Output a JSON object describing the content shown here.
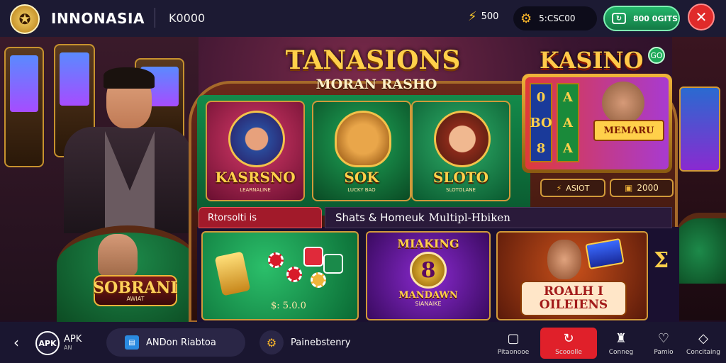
{
  "header": {
    "logo_icon": "crest-logo-icon",
    "brand": "INNONASIA",
    "balance": "K0000",
    "stars": "500",
    "coins": "5:CSC00",
    "deposit_label": "800 0GITS",
    "close_icon": "close-icon"
  },
  "hero": {
    "title": "TANASIONS",
    "subtitle": "MORAN RASHO"
  },
  "games": [
    {
      "name": "KASRSNO",
      "tag": "LEARNALINE"
    },
    {
      "name": "SOK",
      "tag": "LUCKY BAO"
    },
    {
      "name": "SLOTO",
      "tag": "SLOTOLANE"
    }
  ],
  "featured": {
    "title": "KASINO",
    "badge": "GO",
    "reel_a": [
      "0",
      "BO",
      "8"
    ],
    "reel_b": [
      "A",
      "A",
      "A"
    ],
    "label": "MEMARU",
    "button1": "ASIOT",
    "button2": "2000"
  },
  "sections": {
    "tab": "Rtorsolti is",
    "bar_prefix": "Shats & Homeuk",
    "bar_suffix": "Multipl-Hbiken"
  },
  "lower_tiles": {
    "tile1_price": "5.0.0",
    "tile1_price_prefix": "$:",
    "tile2_top": "MIAKING",
    "tile2_number": "8",
    "tile2_bottom": "MANDAWN",
    "tile2_tag": "SIANAIKE",
    "tile3_line1": "ROALH I",
    "tile3_line2": "OILEIENS"
  },
  "left_badge": {
    "title": "SOBRANI",
    "tag": "AWIAT"
  },
  "bottom": {
    "apk": "APK",
    "apk_main": "APK",
    "apk_sub": "AN",
    "android": "ANDon Riabtoa",
    "partner": "Painebstenry",
    "nav": [
      {
        "label": "Pitaonooe",
        "icon": "square-icon"
      },
      {
        "label": "Scooolle",
        "icon": "refresh-icon"
      },
      {
        "label": "Conneg",
        "icon": "trophy-icon"
      },
      {
        "label": "Pamio",
        "icon": "heart-icon"
      },
      {
        "label": "Concitaing",
        "icon": "diamond-icon"
      }
    ]
  },
  "colors": {
    "accent_gold": "#ffd04a",
    "deposit_green": "#23b56a",
    "close_red": "#e02a2a",
    "active_nav": "#e0202a"
  }
}
